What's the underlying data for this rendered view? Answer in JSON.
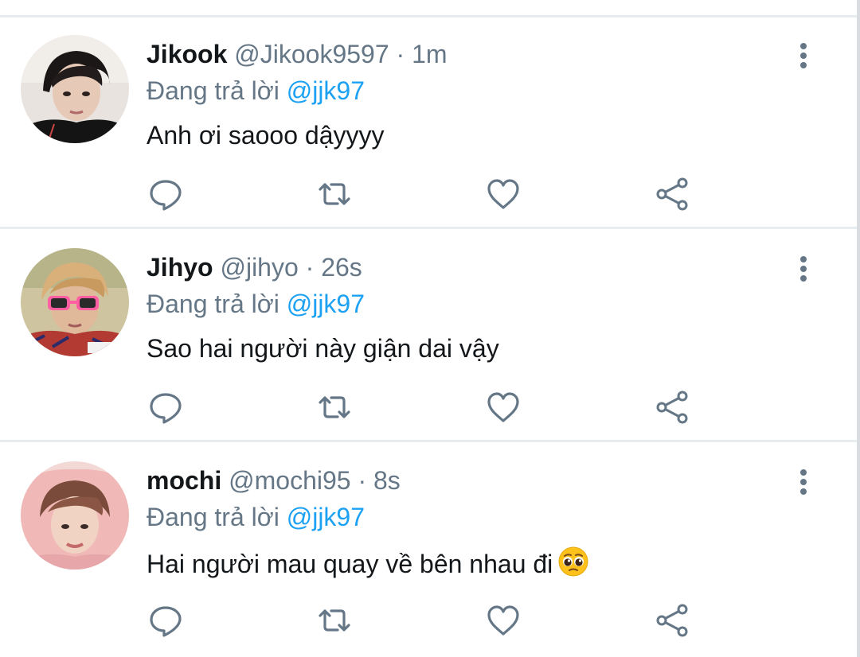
{
  "reply_prefix": "Đang trả lời",
  "separator": "·",
  "colors": {
    "text": "#14171a",
    "secondary": "#657786",
    "link": "#1da1f2",
    "divider": "#e6ecf0",
    "icon": "#657786"
  },
  "action_icons": [
    "reply-icon",
    "retweet-icon",
    "like-icon",
    "share-icon"
  ],
  "tweets": [
    {
      "name": "Jikook",
      "handle": "@Jikook9597",
      "time": "1m",
      "reply_to": "@jjk97",
      "text": "Anh ơi saooo dậyyyy",
      "has_emoji": false
    },
    {
      "name": "Jihyo",
      "handle": "@jihyo",
      "time": "26s",
      "reply_to": "@jjk97",
      "text": "Sao hai người này giận dai vậy",
      "has_emoji": false
    },
    {
      "name": "mochi",
      "handle": "@mochi95",
      "time": "8s",
      "reply_to": "@jjk97",
      "text": "Hai người mau quay về bên nhau đi",
      "has_emoji": true,
      "emoji_name": "pleading-face-emoji"
    }
  ]
}
